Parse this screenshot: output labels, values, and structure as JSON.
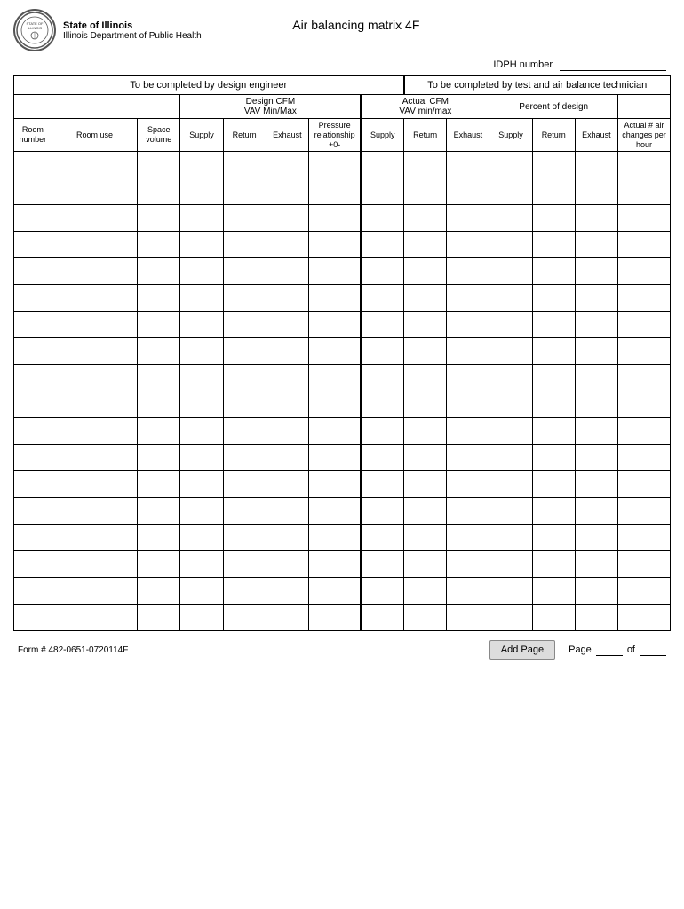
{
  "header": {
    "state": "State of Illinois",
    "dept": "Illinois Department of Public Health",
    "title": "Air balancing matrix  4F",
    "idph_label": "IDPH number"
  },
  "sections": {
    "design_label": "To be completed by  design engineer",
    "test_label": "To be completed by test and air balance technician"
  },
  "sub_headers": {
    "design_cfm": "Design CFM",
    "vav_min_max": "VAV Min/Max",
    "actual_cfm": "Actual CFM",
    "vav_min_max2": "VAV min/max",
    "percent_design": "Percent of design"
  },
  "col_headers": {
    "room_number": "Room number",
    "room_use": "Room use",
    "space_volume": "Space volume",
    "supply": "Supply",
    "return": "Return",
    "exhaust": "Exhaust",
    "pressure_relationship": "Pressure relationship +0-",
    "supply2": "Supply",
    "return2": "Return",
    "exhaust2": "Exhaust",
    "supply3": "Supply",
    "return3": "Return",
    "exhaust3": "Exhaust",
    "actual_air": "Actual # air changes per hour"
  },
  "data_rows": 18,
  "footer": {
    "form_number": "Form # 482-0651-0720114F",
    "add_page_btn": "Add Page",
    "page_label": "Page",
    "of_label": "of"
  }
}
